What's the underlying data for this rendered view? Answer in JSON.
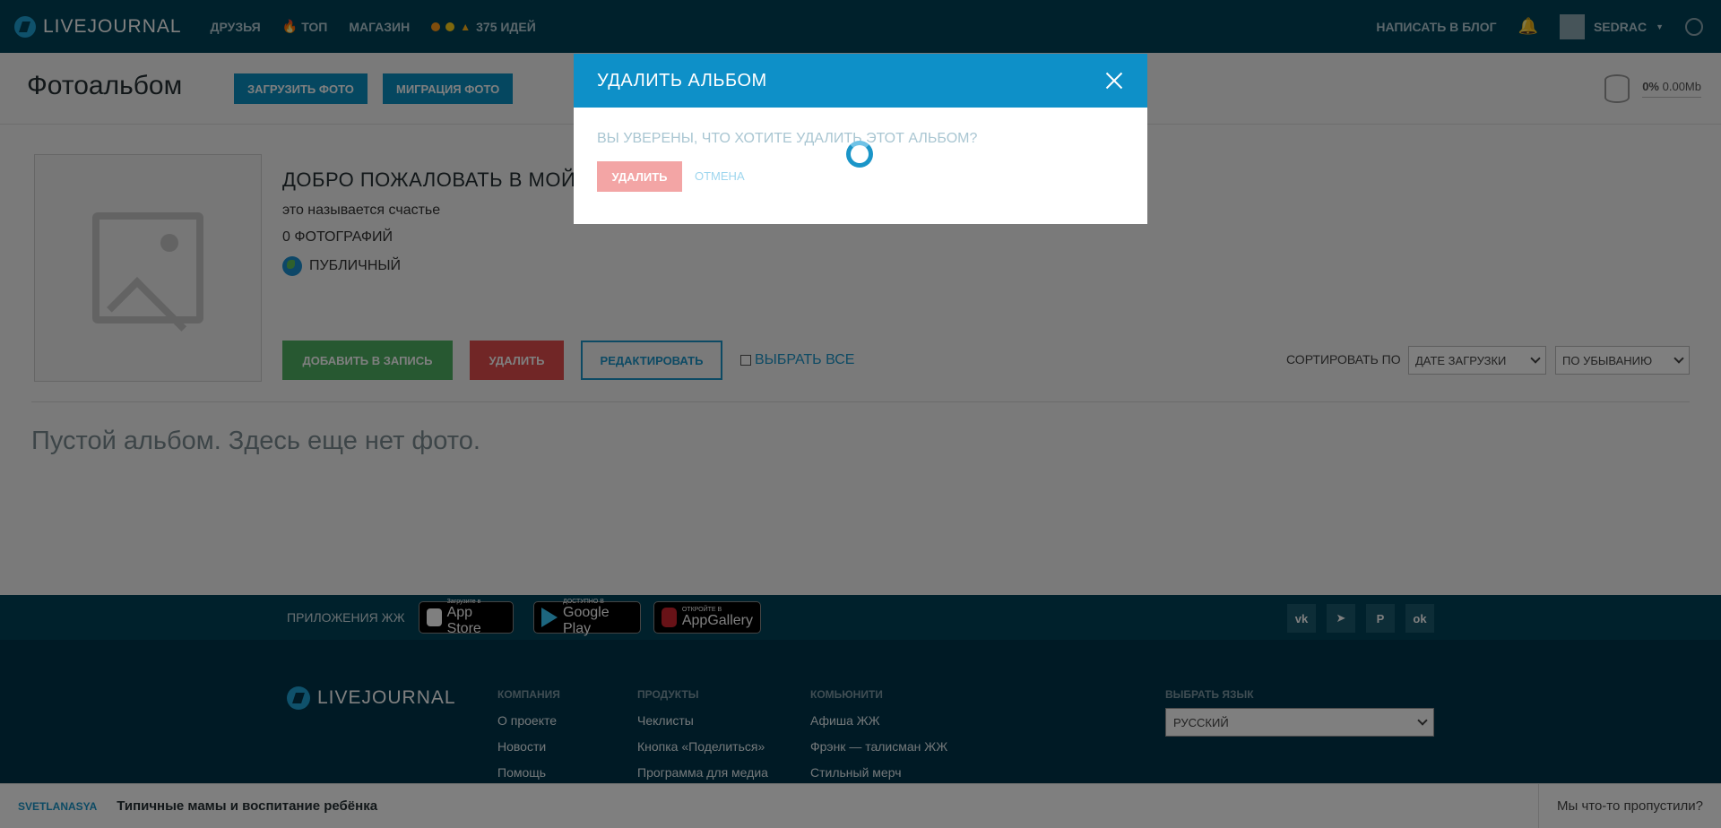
{
  "header": {
    "logo": "LIVEJOURNAL",
    "nav": [
      "ДРУЗЬЯ",
      "ТОП",
      "МАГАЗИН"
    ],
    "ideas": "375 ИДЕЙ",
    "write": "НАПИСАТЬ В БЛОГ",
    "user": "SEDRAC"
  },
  "subheader": {
    "title": "Фотоальбом",
    "upload_btn": "ЗАГРУЗИТЬ ФОТО",
    "migrate_btn": "МИГРАЦИЯ ФОТО",
    "storage_percent": "0%",
    "storage_size": "0.00Mb"
  },
  "album": {
    "title": "ДОБРО ПОЖАЛОВАТЬ В МОЙ",
    "description": "это называется счастье",
    "count": "0 ФОТОГРАФИЙ",
    "visibility": "ПУБЛИЧНЫЙ",
    "add_btn": "ДОБАВИТЬ В ЗАПИСЬ",
    "delete_btn": "УДАЛИТЬ",
    "edit_btn": "РЕДАКТИРОВАТЬ",
    "select_all": "ВЫБРАТЬ ВСЕ",
    "sort_label": "СОРТИРОВАТЬ ПО",
    "sort_by": "ДАТЕ ЗАГРУЗКИ",
    "sort_order": "ПО УБЫВАНИЮ",
    "empty_message": "Пустой альбом. Здесь еще нет фото."
  },
  "footer": {
    "apps_label": "ПРИЛОЖЕНИЯ ЖЖ",
    "appstore_small": "Загрузите в",
    "appstore_big": "App Store",
    "gplay_small": "ДОСТУПНО В",
    "gplay_big": "Google Play",
    "appgallery_small": "ОТКРОЙТЕ В",
    "appgallery_big": "AppGallery",
    "logo": "LIVEJOURNAL",
    "col1": {
      "head": "КОМПАНИЯ",
      "items": [
        "О проекте",
        "Новости",
        "Помощь"
      ]
    },
    "col2": {
      "head": "ПРОДУКТЫ",
      "items": [
        "Чеклисты",
        "Кнопка «Поделиться»",
        "Программа для медиа"
      ]
    },
    "col3": {
      "head": "КОМЬЮНИТИ",
      "items": [
        "Афиша ЖЖ",
        "Фрэнк — талисман ЖЖ",
        "Стильный мерч"
      ]
    },
    "lang_head": "ВЫБРАТЬ ЯЗЫК",
    "lang": "РУССКИЙ"
  },
  "bottom_bar": {
    "user": "SVETLANASYA",
    "title": "Типичные мамы и воспитание ребёнка",
    "right": "Мы что-то пропустили?"
  },
  "modal": {
    "title": "УДАЛИТЬ АЛЬБОМ",
    "question": "ВЫ УВЕРЕНЫ, ЧТО ХОТИТЕ УДАЛИТЬ ЭТОТ АЛЬБОМ?",
    "delete_btn": "УДАЛИТЬ",
    "cancel_btn": "ОТМЕНА"
  },
  "colors": {
    "header_bg": "#004359",
    "accent": "#0e90c8",
    "danger": "#e24c4c",
    "success": "#4fb062"
  }
}
